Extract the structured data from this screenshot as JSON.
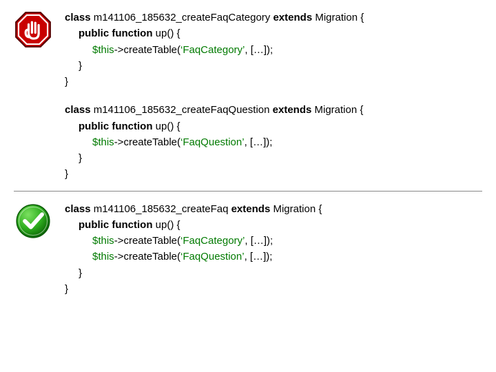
{
  "bad": {
    "blocks": [
      {
        "class_kw1": "class",
        "class_name": " m141106_185632_createFaqCategory ",
        "class_kw2": "extends",
        "class_parent": " Migration {",
        "fn_kw": "public function",
        "fn_rest": " up() {",
        "stmt_this": "$this",
        "stmt_mid": "->createTable(",
        "stmt_str": "‘FaqCategory’",
        "stmt_end": ", […]);",
        "close_fn": "}",
        "close_cls": "}"
      },
      {
        "class_kw1": "class",
        "class_name": " m141106_185632_createFaqQuestion ",
        "class_kw2": "extends",
        "class_parent": " Migration {",
        "fn_kw": "public function",
        "fn_rest": " up() {",
        "stmt_this": "$this",
        "stmt_mid": "->createTable(",
        "stmt_str": "‘FaqQuestion’",
        "stmt_end": ", […]);",
        "close_fn": "}",
        "close_cls": "}"
      }
    ]
  },
  "good": {
    "class_kw1": "class",
    "class_name": " m141106_185632_createFaq ",
    "class_kw2": "extends",
    "class_parent": " Migration {",
    "fn_kw": "public function",
    "fn_rest": " up() {",
    "stmts": [
      {
        "this": "$this",
        "mid": "->createTable(",
        "str": "‘FaqCategory’",
        "end": ", […]);"
      },
      {
        "this": "$this",
        "mid": "->createTable(",
        "str": "‘FaqQuestion’",
        "end": ", […]);"
      }
    ],
    "close_fn": "}",
    "close_cls": "}"
  }
}
